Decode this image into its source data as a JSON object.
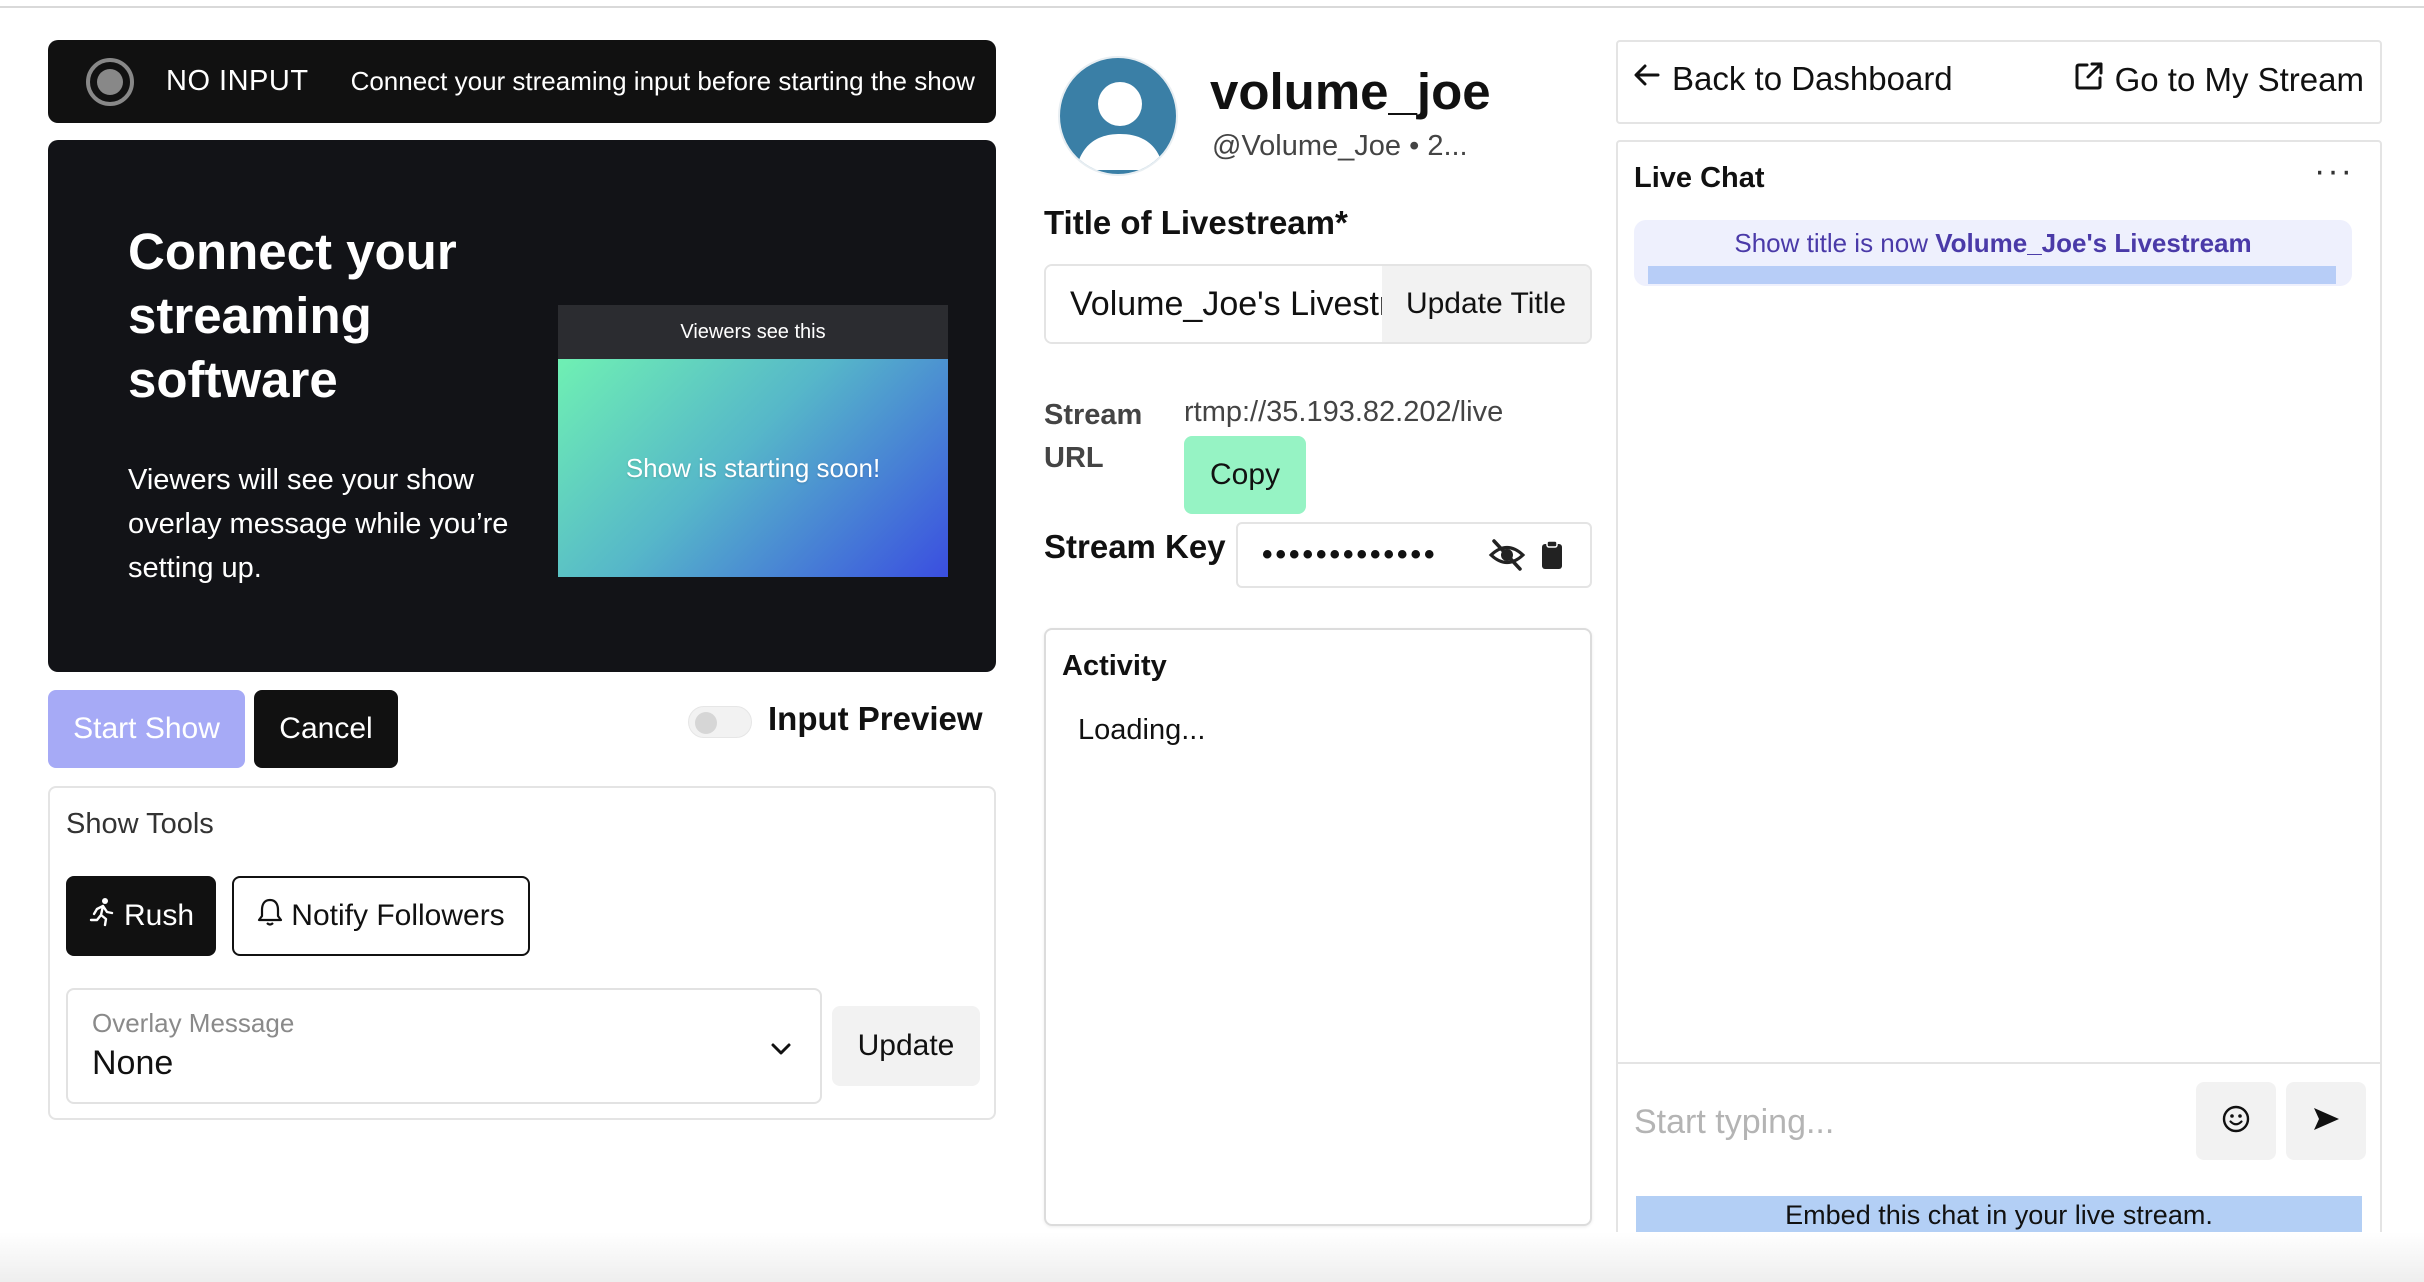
{
  "status": {
    "label": "NO INPUT",
    "message": "Connect your streaming input before starting the show"
  },
  "connect": {
    "title": "Connect your streaming software",
    "description": "Viewers will see your show overlay message while you’re setting up.",
    "preview_header": "Viewers see this",
    "preview_message": "Show is starting soon!"
  },
  "actions": {
    "start_label": "Start Show",
    "cancel_label": "Cancel",
    "input_preview_label": "Input Preview",
    "input_preview_on": false
  },
  "tools": {
    "title": "Show Tools",
    "rush_label": "Rush",
    "notify_label": "Notify Followers",
    "overlay_label": "Overlay Message",
    "overlay_value": "None",
    "update_label": "Update"
  },
  "profile": {
    "name": "volume_joe",
    "handle": "@Volume_Joe • 2..."
  },
  "stream": {
    "title_label": "Title of Livestream*",
    "title_value": "Volume_Joe's Livestream",
    "update_title_label": "Update Title",
    "url_label": "Stream URL",
    "url_value": "rtmp://35.193.82.202/live",
    "copy_label": "Copy",
    "key_label": "Stream Key",
    "key_masked": "•••••••••••••"
  },
  "activity": {
    "title": "Activity",
    "status": "Loading..."
  },
  "nav": {
    "back_label": "Back to Dashboard",
    "go_label": "Go to My Stream"
  },
  "chat": {
    "title": "Live Chat",
    "more": "···",
    "system_prefix": "Show title is now ",
    "system_title": "Volume_Joe's Livestream",
    "placeholder": "Start typing...",
    "embed_label": "Embed this chat in your live stream."
  },
  "colors": {
    "start_button": "#a6aaf6",
    "copy_button": "#96f3c4",
    "chat_system_bg": "#eef0fd",
    "chat_system_text": "#4a3aa8",
    "embed_highlight": "#b3cff5",
    "avatar": "#3a7fa6"
  },
  "icons": {
    "status": "record-icon",
    "rush": "running-person-icon",
    "notify": "bell-icon",
    "overlay": "chevron-down-icon",
    "key_hide": "eye-off-icon",
    "key_copy": "clipboard-icon",
    "back": "arrow-left-icon",
    "go": "external-link-icon",
    "more": "more-horizontal-icon",
    "emoji": "smiley-icon",
    "send": "send-icon"
  }
}
